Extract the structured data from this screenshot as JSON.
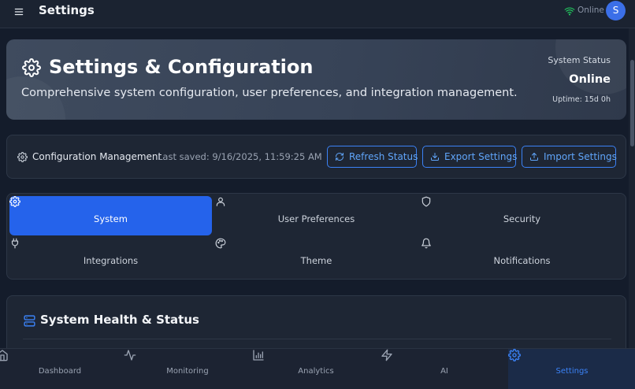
{
  "app": {
    "title": "Settings",
    "connection_status": "Online",
    "avatar_initial": "S"
  },
  "hero": {
    "title": "Settings & Configuration",
    "subtitle": "Comprehensive system configuration, user preferences, and integration management.",
    "system_status_label": "System Status",
    "system_status_value": "Online",
    "uptime": "Uptime: 15d 0h"
  },
  "config_bar": {
    "title": "Configuration Management",
    "last_saved": "Last saved: 9/16/2025, 11:59:25 AM",
    "buttons": {
      "refresh": "Refresh Status",
      "export": "Export Settings",
      "import": "Import Settings"
    }
  },
  "tabs": [
    {
      "label": "System",
      "icon": "gear-icon",
      "active": true
    },
    {
      "label": "User Preferences",
      "icon": "user-icon",
      "active": false
    },
    {
      "label": "Security",
      "icon": "shield-icon",
      "active": false
    },
    {
      "label": "Integrations",
      "icon": "plug-icon",
      "active": false
    },
    {
      "label": "Theme",
      "icon": "palette-icon",
      "active": false
    },
    {
      "label": "Notifications",
      "icon": "bell-icon",
      "active": false
    }
  ],
  "health": {
    "title": "System Health & Status"
  },
  "bottom_nav": [
    {
      "label": "Dashboard",
      "icon": "home-icon",
      "active": false
    },
    {
      "label": "Monitoring",
      "icon": "activity-icon",
      "active": false
    },
    {
      "label": "Analytics",
      "icon": "bar-chart-icon",
      "active": false
    },
    {
      "label": "AI",
      "icon": "lightning-icon",
      "active": false
    },
    {
      "label": "Settings",
      "icon": "gear-icon",
      "active": true
    }
  ],
  "colors": {
    "background": "#141c2b",
    "accent": "#2563eb",
    "accent_light": "#3b82f6",
    "online": "#22c55e"
  }
}
